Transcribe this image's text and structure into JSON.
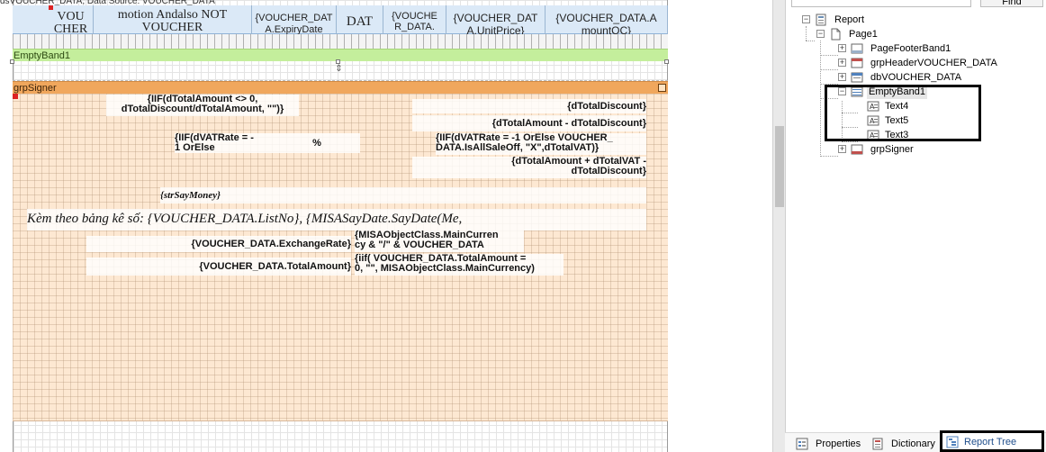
{
  "designer": {
    "top_cut_text": "dsVOUCHER_DATA, Data Source: VOUCHER_DATA",
    "detail_cells": [
      {
        "text": "VOU\nCHER"
      },
      {
        "text": "motion Andalso NOT\nVOUCHER"
      },
      {
        "text": "{VOUCHER_DAT\nA.ExpiryDate"
      },
      {
        "text": "DAT"
      },
      {
        "text": "{VOUCHE\nR_DATA."
      },
      {
        "text": "{VOUCHER_DAT\nA.UnitPrice}"
      },
      {
        "text": "{VOUCHER_DATA.A\nmountOC}"
      }
    ],
    "emptyband_label": "EmptyBand1",
    "grpsigner_label": "grpSigner",
    "textboxes": {
      "total_amount_discount": "{IIF(dTotalAmount <> 0,\ndTotalDiscount/dTotalAmount, \"\")}",
      "total_discount": "{dTotalDiscount}",
      "amount_minus_discount": "{dTotalAmount - dTotalDiscount}",
      "vat_rate": "{IIF(dVATRate = -\n1 OrElse",
      "percent": "%",
      "vat_amount": "{IIF(dVATRate = -1 OrElse VOUCHER_\nDATA.IsAllSaleOff, \"X\",dTotalVAT)}",
      "amount_plus_vat": "{dTotalAmount + dTotalVAT -\ndTotalDiscount}",
      "say_money": "{strSayMoney}",
      "list_no": "Kèm theo bảng kê số: {VOUCHER_DATA.ListNo}, {MISASayDate.SayDate(Me,\nVOUCHER_DATA.ListDate)}",
      "exchange_rate": "{VOUCHER_DATA.ExchangeRate}",
      "main_currency": "{MISAObjectClass.MainCurren\ncy & \"/\" & VOUCHER_DATA",
      "total_amount": "{VOUCHER_DATA.TotalAmount}",
      "total_amount_iif": "{iif( VOUCHER_DATA.TotalAmount =\n0, \"\", MISAObjectClass.MainCurrency)"
    }
  },
  "panel": {
    "find_label": "Find",
    "search_placeholder": "",
    "tree": [
      {
        "label": "Report"
      },
      {
        "label": "Page1"
      },
      {
        "label": "PageFooterBand1"
      },
      {
        "label": "grpHeaderVOUCHER_DATA"
      },
      {
        "label": "dbVOUCHER_DATA"
      },
      {
        "label": "EmptyBand1"
      },
      {
        "label": "Text4"
      },
      {
        "label": "Text5"
      },
      {
        "label": "Text3"
      },
      {
        "label": "grpSigner"
      }
    ],
    "tabs": {
      "properties": "Properties",
      "dictionary": "Dictionary",
      "report_tree": "Report Tree"
    }
  },
  "colors": {
    "emptyband": "#c4ee9c",
    "grpsigner": "#f0a75d",
    "detail": "#dbe9f7",
    "highlight": "#000000"
  }
}
